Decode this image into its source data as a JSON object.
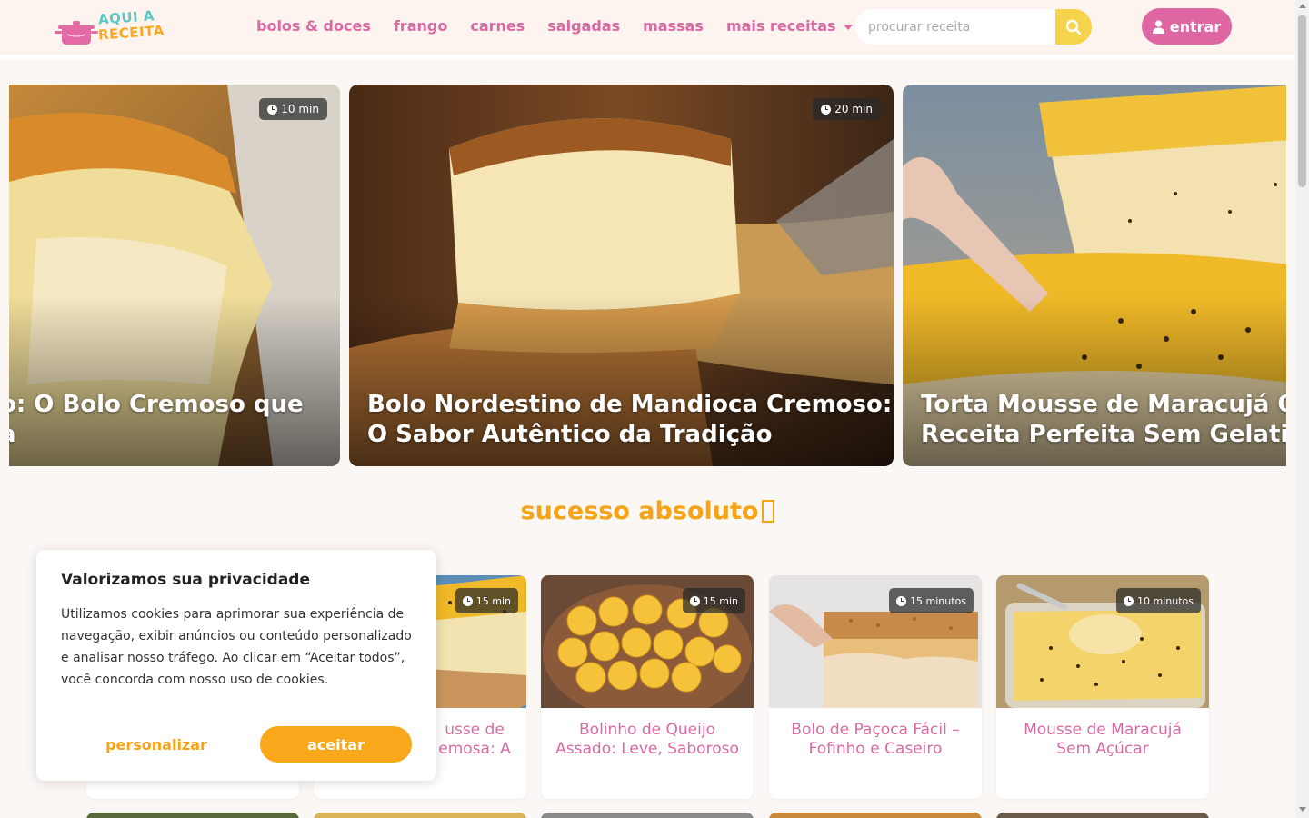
{
  "brand": {
    "logo_line1": "AQUI A",
    "logo_line2": "RECEITA"
  },
  "nav": {
    "items": [
      {
        "label": "bolos & doces"
      },
      {
        "label": "frango"
      },
      {
        "label": "carnes"
      },
      {
        "label": "salgadas"
      },
      {
        "label": "massas"
      },
      {
        "label": "mais receitas"
      }
    ]
  },
  "search": {
    "placeholder": "procurar receita",
    "icon": "search-icon"
  },
  "login": {
    "label": "entrar",
    "icon": "user-icon"
  },
  "carousel": {
    "slides": [
      {
        "title_line1": "o: O Bolo Cremoso que",
        "title_line2": "a",
        "time": "10 min"
      },
      {
        "title_line1": "Bolo Nordestino de Mandioca Cremoso:",
        "title_line2": "O Sabor Autêntico da Tradição",
        "time": "20 min"
      },
      {
        "title_line1": "Torta Mousse de Maracujá O",
        "title_line2": "Receita Perfeita Sem Gelatin",
        "time": ""
      }
    ]
  },
  "section": {
    "title": "sucesso absoluto"
  },
  "cards": [
    {
      "title": "",
      "time": ""
    },
    {
      "title_line1": "usse de",
      "title_line2": "emosa: A",
      "time": "15 min"
    },
    {
      "title_line1": "Bolinho de Queijo",
      "title_line2": "Assado: Leve, Saboroso",
      "time": "15 min"
    },
    {
      "title_line1": "Bolo de Paçoca Fácil –",
      "title_line2": "Fofinho e Caseiro",
      "time": "15 minutos"
    },
    {
      "title_line1": "Mousse de Maracujá",
      "title_line2": "Sem Açúcar",
      "time": "10 minutos"
    }
  ],
  "cookie": {
    "title": "Valorizamos sua privacidade",
    "body": "Utilizamos cookies para aprimorar sua experiência de navegação, exibir anúncios ou conteúdo personalizado e analisar nosso tráfego. Ao clicar em “Aceitar todos”, você concorda com nosso uso de cookies.",
    "personalize_label": "personalizar",
    "accept_label": "aceitar"
  },
  "colors": {
    "brand_pink": "#de66a2",
    "accent_orange": "#f9a81b",
    "search_yellow": "#f5d34a"
  }
}
